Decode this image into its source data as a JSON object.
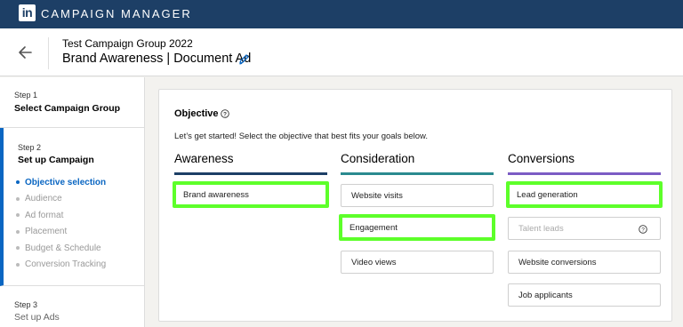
{
  "topbar": {
    "logo_text": "in",
    "app_title": "CAMPAIGN MANAGER",
    "color": "#1d3f66"
  },
  "header": {
    "group_name": "Test Campaign Group 2022",
    "campaign_name": "Brand Awareness | Document Ad"
  },
  "sidebar": {
    "step1": {
      "num": "Step 1",
      "title": "Select Campaign Group"
    },
    "step2": {
      "num": "Step 2",
      "title": "Set up Campaign",
      "substeps": [
        {
          "label": "Objective selection"
        },
        {
          "label": "Audience"
        },
        {
          "label": "Ad format"
        },
        {
          "label": "Placement"
        },
        {
          "label": "Budget & Schedule"
        },
        {
          "label": "Conversion Tracking"
        }
      ]
    },
    "step3": {
      "num": "Step 3",
      "title": "Set up Ads"
    }
  },
  "objective": {
    "title": "Objective",
    "description": "Let’s get started! Select the objective that best fits your goals below.",
    "columns": [
      {
        "heading": "Awareness",
        "options": [
          {
            "label": "Brand awareness"
          }
        ]
      },
      {
        "heading": "Consideration",
        "options": [
          {
            "label": "Website visits"
          },
          {
            "label": "Engagement"
          },
          {
            "label": "Video views"
          }
        ]
      },
      {
        "heading": "Conversions",
        "options": [
          {
            "label": "Lead generation"
          },
          {
            "label": "Talent leads"
          },
          {
            "label": "Website conversions"
          },
          {
            "label": "Job applicants"
          }
        ]
      }
    ]
  },
  "colors": {
    "accent": "#0a66c2",
    "highlight": "#5dff2a",
    "awareness_bar": "#1d3f66",
    "consideration_bar": "#2a8a8f",
    "conversions_bar": "#7b5cc4"
  },
  "icons": {
    "back": "arrow-left-icon",
    "edit": "pencil-icon",
    "help": "question-circle-icon"
  }
}
